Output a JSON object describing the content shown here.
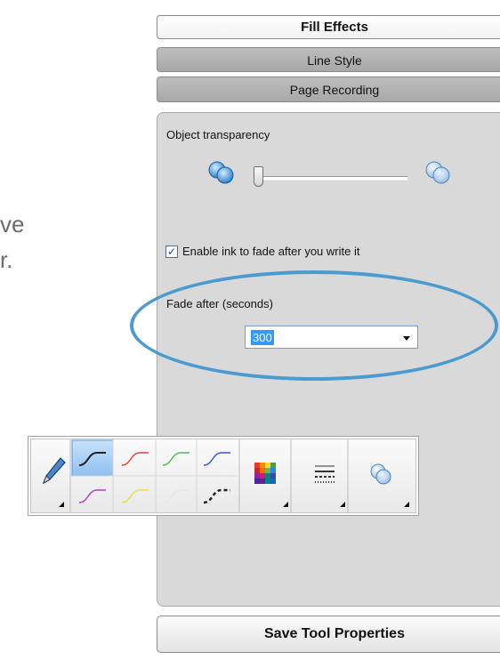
{
  "background_fragment": {
    "line1": "ve",
    "line2": "r."
  },
  "tabs": [
    {
      "label": "Fill Effects",
      "active": true
    },
    {
      "label": "Line Style",
      "active": false
    },
    {
      "label": "Page Recording",
      "active": false
    }
  ],
  "panel": {
    "transparency_label": "Object transparency",
    "transparency_value": 0.05,
    "fade_checkbox_label": "Enable ink to fade after you write it",
    "fade_checked": true,
    "fade_after_label": "Fade after (seconds)",
    "fade_after_value": "300"
  },
  "toolbar": {
    "pen_icon": "pen-icon",
    "line_colors_row1": [
      "#222222",
      "#e8413c",
      "#47c24a",
      "#3c4fe0"
    ],
    "line_colors_row2": [
      "#b23ec0",
      "#e8e23a",
      "#eeeeee",
      "#222222"
    ],
    "palette_icon": "color-palette-icon",
    "line_style_icon": "line-style-icon",
    "fill_effects_icon": "transparency-icon",
    "selected_color": "#222222"
  },
  "save_button_label": "Save Tool Properties",
  "colors": {
    "accent_ellipse": "#4b9bd1",
    "selection": "#3399ff",
    "toolbar_selected": "#9cc8f5"
  }
}
